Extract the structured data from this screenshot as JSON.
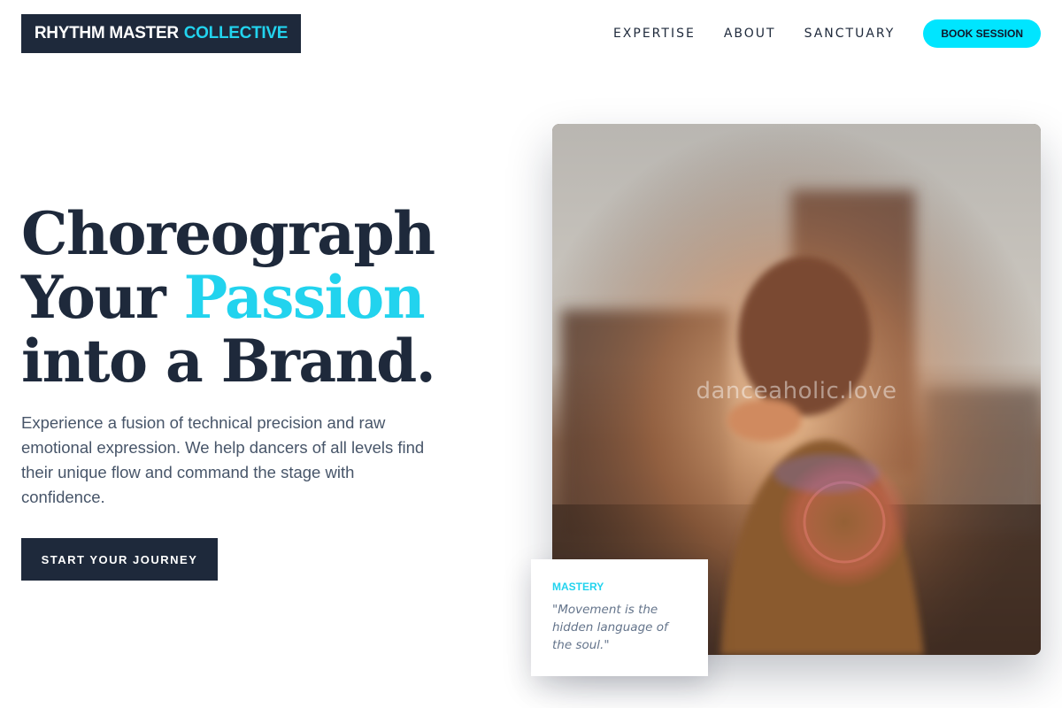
{
  "brand": {
    "name": "RHYTHM MASTER",
    "accent": "COLLECTIVE"
  },
  "nav": {
    "items": [
      {
        "label": "EXPERTISE"
      },
      {
        "label": "ABOUT"
      },
      {
        "label": "SANCTUARY"
      }
    ],
    "cta_label": "BOOK SESSION"
  },
  "hero": {
    "headline_line1": "Choreograph",
    "headline_line2_prefix": "Your",
    "headline_line2_accent": "Passion",
    "headline_line3": "into a Brand.",
    "subtext": "Experience a fusion of technical precision and raw emotional expression. We help dancers of all levels find their unique flow and command the stage with confidence.",
    "cta_label": "START YOUR JOURNEY"
  },
  "image": {
    "watermark": "danceaholic.love",
    "icon": "dancer-photo"
  },
  "quote_card": {
    "label": "MASTERY",
    "text": "\"Movement is the hidden language of the soul.\""
  },
  "colors": {
    "primary_dark": "#1e293b",
    "accent": "#22d3ee",
    "button_accent": "#00e5ff",
    "body_text": "#475569"
  }
}
